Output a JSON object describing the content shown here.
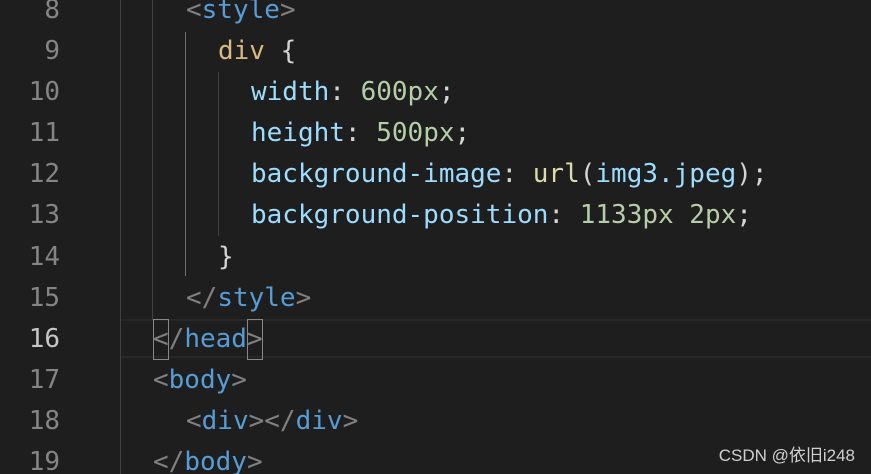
{
  "editor": {
    "line_numbers": [
      "8",
      "9",
      "10",
      "11",
      "12",
      "13",
      "14",
      "15",
      "16",
      "17",
      "18",
      "19"
    ],
    "active_line": "16",
    "lines": {
      "l8": {
        "open": "<",
        "tag": "style",
        "close": ">"
      },
      "l9": {
        "selector": "div",
        "brace": " {"
      },
      "l10": {
        "prop": "width",
        "colon": ": ",
        "value": "600px",
        "semi": ";"
      },
      "l11": {
        "prop": "height",
        "colon": ": ",
        "value": "500px",
        "semi": ";"
      },
      "l12": {
        "prop": "background-image",
        "colon": ": ",
        "fn": "url",
        "paren_open": "(",
        "arg": "img3.jpeg",
        "paren_close": ");"
      },
      "l13": {
        "prop": "background-position",
        "colon": ": ",
        "value": "1133px 2px",
        "semi": ";"
      },
      "l14": {
        "brace": "}"
      },
      "l15": {
        "open": "</",
        "tag": "style",
        "close": ">"
      },
      "l16": {
        "open_lt": "<",
        "open_slash": "/",
        "tag": "head",
        "close": ">"
      },
      "l17": {
        "open": "<",
        "tag": "body",
        "close": ">"
      },
      "l18": {
        "open1": "<",
        "tag1": "div",
        "close1": "></",
        "tag2": "div",
        "close2": ">"
      },
      "l19": {
        "open": "</",
        "tag": "body",
        "close": ">"
      }
    }
  },
  "colors": {
    "background": "#1e1e1e",
    "line_number": "#858585",
    "tag": "#569cd6",
    "bracket": "#808080",
    "selector": "#d7ba7d",
    "property": "#9cdcfe",
    "number": "#b5cea8",
    "function": "#dcdcaa"
  },
  "watermark": "CSDN @依旧i248"
}
